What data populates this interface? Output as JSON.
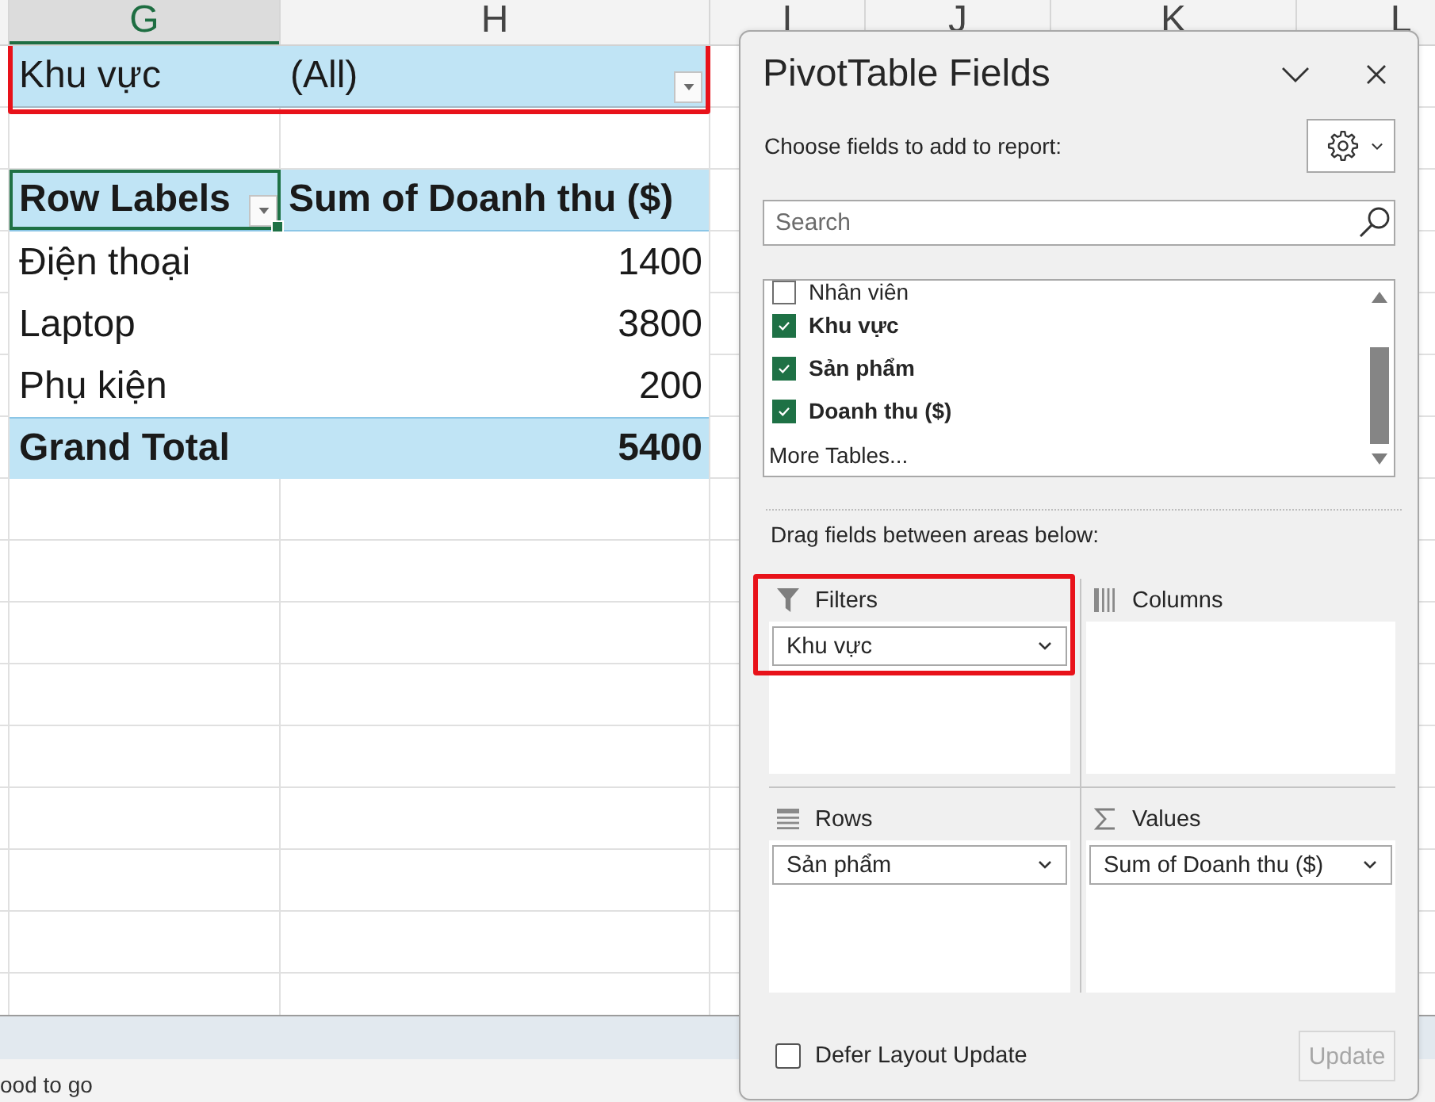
{
  "sheet": {
    "columns": [
      {
        "label": "G",
        "selected": true
      },
      {
        "label": "H",
        "selected": false
      },
      {
        "label": "I",
        "selected": false
      },
      {
        "label": "J",
        "selected": false
      },
      {
        "label": "K",
        "selected": false
      },
      {
        "label": "L",
        "selected": false
      }
    ],
    "report_filter": {
      "field": "Khu vực",
      "value": "(All)",
      "highlighted": true
    },
    "pivot": {
      "headers": [
        {
          "text": "Row Labels",
          "selected": true,
          "dropdown": true
        },
        {
          "text": "Sum of Doanh thu ($)",
          "selected": false,
          "dropdown": false
        }
      ],
      "rows": [
        {
          "label": "Điện thoại",
          "value": "1400"
        },
        {
          "label": "Laptop",
          "value": "3800"
        },
        {
          "label": "Phụ kiện",
          "value": "200"
        }
      ],
      "grand_total": {
        "label": "Grand Total",
        "value": "5400"
      }
    }
  },
  "status_bar": {
    "text": "ood to go"
  },
  "panel": {
    "title": "PivotTable Fields",
    "subtitle": "Choose fields to add to report:",
    "search": {
      "placeholder": "Search"
    },
    "fields": [
      {
        "name": "Nhân viên",
        "checked": false
      },
      {
        "name": "Khu vực",
        "checked": true
      },
      {
        "name": "Sản phẩm",
        "checked": true
      },
      {
        "name": "Doanh thu ($)",
        "checked": true
      }
    ],
    "more_tables": "More Tables...",
    "areas_hint": "Drag fields between areas below:",
    "areas": [
      {
        "kind": "filters",
        "title": "Filters",
        "highlighted": true,
        "items": [
          "Khu vực"
        ]
      },
      {
        "kind": "columns",
        "title": "Columns",
        "highlighted": false
      },
      {
        "kind": "rows",
        "title": "Rows",
        "highlighted": false,
        "items": [
          "Sản phẩm"
        ]
      },
      {
        "kind": "values",
        "title": "Values",
        "highlighted": false,
        "items": [
          "Sum of Doanh thu ($)"
        ]
      }
    ],
    "defer_layout_update": {
      "label": "Defer Layout Update",
      "checked": false
    },
    "update_button": {
      "label": "Update",
      "disabled": true
    }
  }
}
